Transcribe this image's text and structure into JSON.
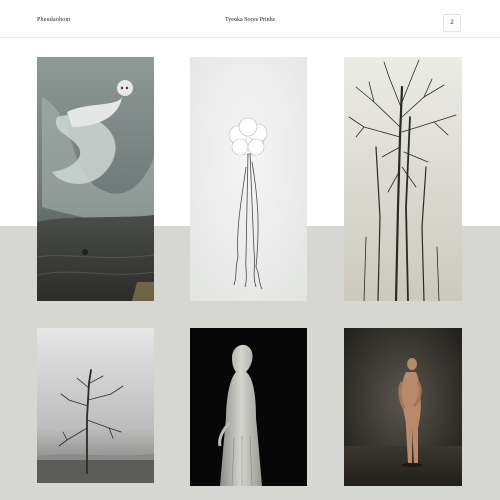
{
  "header": {
    "brand": "Pheudaohom",
    "title": "Tyeoka Soces Prinhs",
    "cart_count": "2"
  },
  "gallery": {
    "items": [
      {
        "name": "ghostly-figure-wave-print",
        "icon": "artwork-ghost-wave"
      },
      {
        "name": "dandelion-tree-print",
        "icon": "artwork-dandelion"
      },
      {
        "name": "bare-trees-print",
        "icon": "artwork-bare-trees"
      },
      {
        "name": "lone-tree-fog-print",
        "icon": "artwork-lone-tree"
      },
      {
        "name": "hooded-figure-print",
        "icon": "artwork-hooded-figure"
      },
      {
        "name": "figure-dark-room-print",
        "icon": "artwork-figure-dark-room"
      }
    ]
  },
  "colors": {
    "page_background": "#d6d6d3",
    "header_background": "#ffffff"
  }
}
